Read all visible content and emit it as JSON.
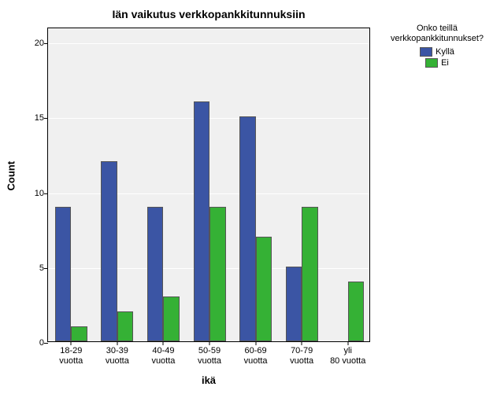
{
  "chart_data": {
    "type": "bar",
    "title": "Iän vaikutus verkkopankkitunnuksiin",
    "xlabel": "ikä",
    "ylabel": "Count",
    "categories": [
      "18-29 vuotta",
      "30-39 vuotta",
      "40-49 vuotta",
      "50-59 vuotta",
      "60-69 vuotta",
      "70-79 vuotta",
      "yli 80 vuotta"
    ],
    "series": [
      {
        "name": "Kyllä",
        "color": "#3b55a4",
        "values": [
          9,
          12,
          9,
          16,
          15,
          5,
          0
        ]
      },
      {
        "name": "Ei",
        "color": "#35b135",
        "values": [
          1,
          2,
          3,
          9,
          7,
          9,
          4
        ]
      }
    ],
    "yticks": [
      0,
      5,
      10,
      15,
      20
    ],
    "ylim": [
      0,
      21
    ],
    "legend": {
      "title_line1": "Onko teillä",
      "title_line2": "verkkopankkitunnukset?"
    }
  }
}
